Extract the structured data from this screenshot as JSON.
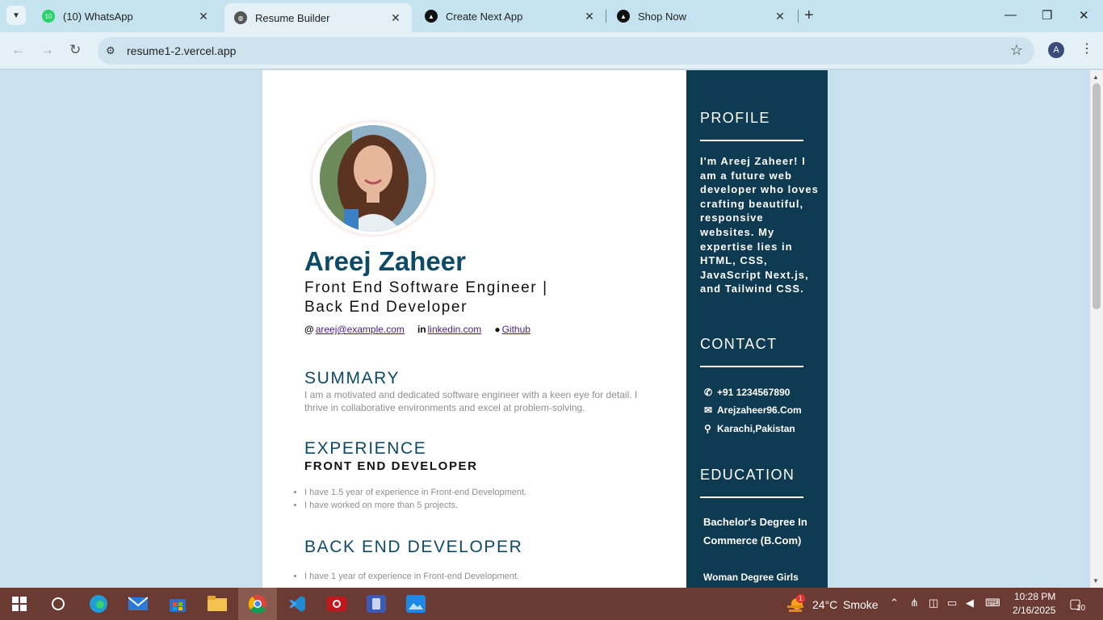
{
  "browser": {
    "tabs": [
      {
        "title": "(10) WhatsApp",
        "badge": "10",
        "icon": "whatsapp-icon",
        "active": false
      },
      {
        "title": "Resume Builder",
        "icon": "globe-icon",
        "active": true
      },
      {
        "title": "Create Next App",
        "icon": "nextjs-icon",
        "active": false
      },
      {
        "title": "Shop Now",
        "icon": "nextjs-icon",
        "active": false
      }
    ],
    "url": "resume1-2.vercel.app",
    "profile_initial": "A"
  },
  "resume": {
    "name": "Areej Zaheer",
    "role": "Front End Software Engineer | Back End Developer",
    "links": {
      "email": "areej@example.com",
      "linkedin": "linkedin.com",
      "github": "Github"
    },
    "summary": {
      "title": "SUMMARY",
      "text": "I am a motivated and dedicated software engineer with a keen eye for detail. I thrive in collaborative environments and excel at problem-solving."
    },
    "experience": {
      "title": "EXPERIENCE",
      "job1": {
        "title": "FRONT END DEVELOPER",
        "points": [
          "I have 1.5 year of experience in Front-end Development.",
          "I have worked on more than 5 projects."
        ]
      },
      "job2": {
        "title": "BACK END DEVELOPER",
        "points": [
          "I have 1 year of experience in Front-end Development."
        ]
      }
    },
    "sidebar": {
      "profile_title": "PROFILE",
      "profile_text": "I'm Areej Zaheer! I am a future web developer who loves crafting beautiful, responsive websites. My expertise lies in HTML, CSS, JavaScript Next.js, and Tailwind CSS.",
      "contact_title": "CONTACT",
      "phone": "+91 1234567890",
      "email": "Arejzaheer96.Com",
      "location": "Karachi,Pakistan",
      "education_title": "EDUCATION",
      "degree": "Bachelor's Degree In Commerce (B.Com)",
      "school": "Woman Degree Girls"
    }
  },
  "taskbar": {
    "weather_temp": "24°C",
    "weather_desc": "Smoke",
    "time": "10:28 PM",
    "date": "2/16/2025",
    "notifications": "10",
    "weather_badge": "1"
  },
  "colors": {
    "accent": "#0e4a66",
    "sidebar_bg": "#0e3a52",
    "page_bg": "#c9e0ee",
    "taskbar_bg": "#6a3a33"
  }
}
